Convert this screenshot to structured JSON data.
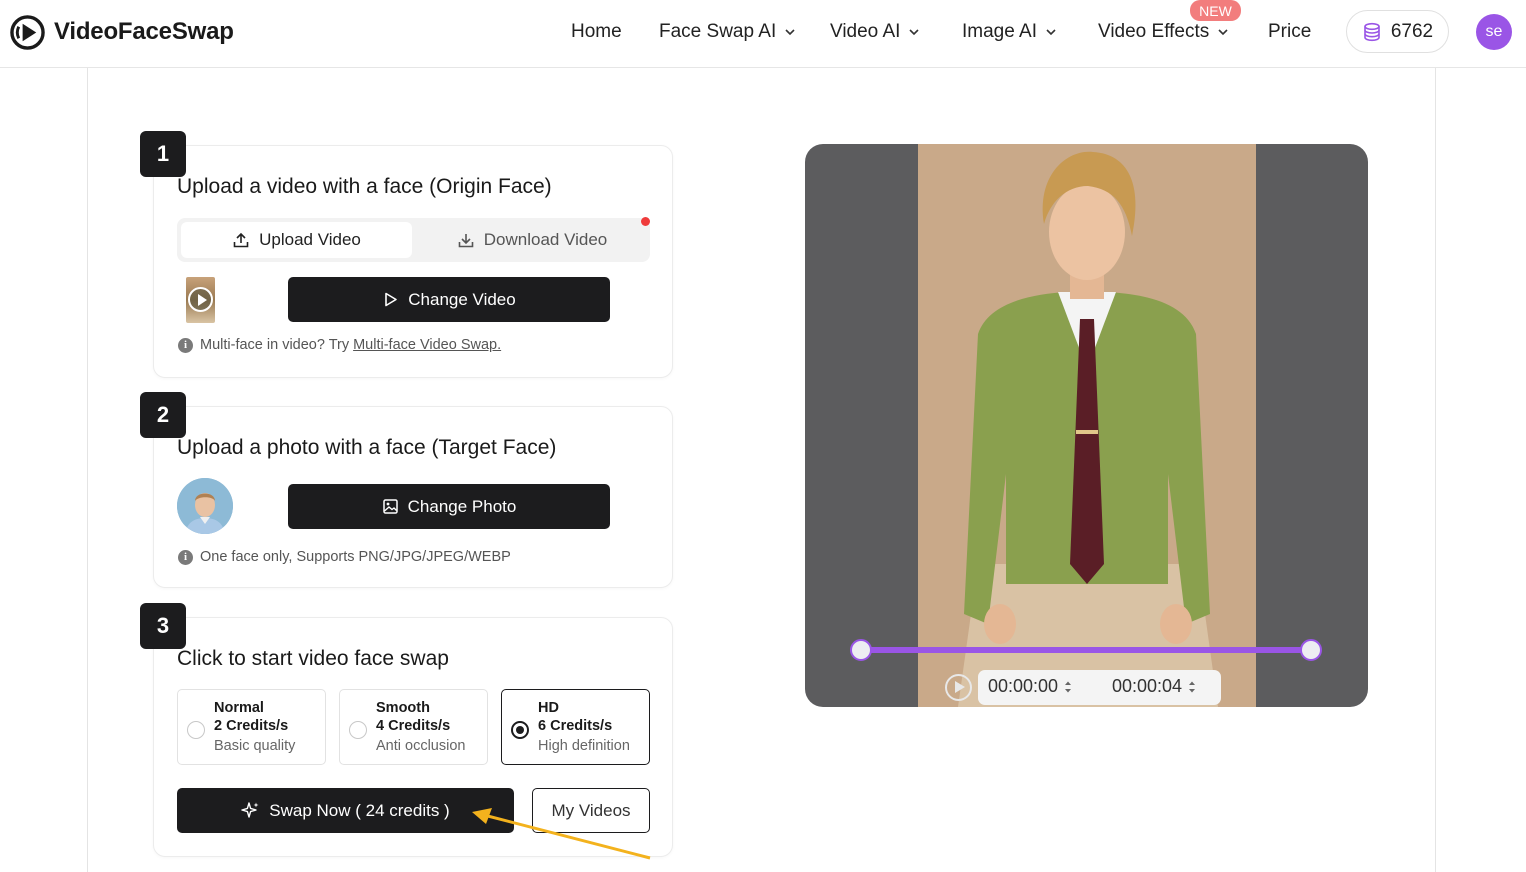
{
  "header": {
    "brand": "VideoFaceSwap",
    "nav": [
      {
        "label": "Home"
      },
      {
        "label": "Face Swap AI"
      },
      {
        "label": "Video AI"
      },
      {
        "label": "Image AI"
      },
      {
        "label": "Video Effects"
      },
      {
        "label": "Price"
      }
    ],
    "new_badge": "NEW",
    "credits": "6762",
    "avatar_initials": "se"
  },
  "step1": {
    "number": "1",
    "title": "Upload a video with a face (Origin Face)",
    "tab_upload": "Upload Video",
    "tab_download": "Download Video",
    "change_button": "Change Video",
    "hint_text": "Multi-face in video? Try",
    "hint_link": "Multi-face Video Swap."
  },
  "step2": {
    "number": "2",
    "title": "Upload a photo with a face  (Target Face)",
    "change_button": "Change Photo",
    "hint_text": "One face only, Supports PNG/JPG/JPEG/WEBP"
  },
  "step3": {
    "number": "3",
    "title": "Click to start video face swap",
    "options": [
      {
        "name": "Normal",
        "credits": "2 Credits/s",
        "desc": "Basic quality",
        "selected": false
      },
      {
        "name": "Smooth",
        "credits": "4 Credits/s",
        "desc": "Anti occlusion",
        "selected": false
      },
      {
        "name": "HD",
        "credits": "6 Credits/s",
        "desc": "High definition",
        "selected": true
      }
    ],
    "swap_button": "Swap Now ( 24 credits )",
    "my_videos_button": "My Videos"
  },
  "preview": {
    "start_time": "00:00:00",
    "end_time": "00:00:04",
    "trim_start": 0,
    "trim_end": 1
  },
  "colors": {
    "accent": "#9a55e6",
    "dark": "#1c1c1e",
    "badge": "#f27d7d",
    "annotation_arrow": "#f3b21d"
  }
}
